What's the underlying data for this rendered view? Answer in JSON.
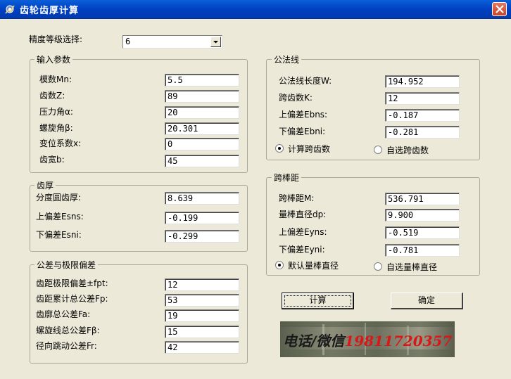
{
  "window": {
    "title": "齿轮齿厚计算",
    "close_label": "×"
  },
  "precision": {
    "label": "精度等级选择:",
    "value": "6"
  },
  "input_group": {
    "title": "输入参数",
    "fields": [
      {
        "label": "模数Mn:",
        "value": "5.5"
      },
      {
        "label": "齿数Z:",
        "value": "89"
      },
      {
        "label": "压力角α:",
        "value": "20"
      },
      {
        "label": "螺旋角β:",
        "value": "20.301"
      },
      {
        "label": "变位系数x:",
        "value": "0"
      },
      {
        "label": "齿宽b:",
        "value": "45"
      }
    ]
  },
  "thickness_group": {
    "title": "齿厚",
    "fields": [
      {
        "label": "分度圆齿厚:",
        "value": "8.639"
      },
      {
        "label": "上偏差Esns:",
        "value": "-0.199"
      },
      {
        "label": "下偏差Esni:",
        "value": "-0.299"
      }
    ]
  },
  "tolerance_group": {
    "title": "公差与极限偏差",
    "fields": [
      {
        "label": "齿距极限偏差±fpt:",
        "value": "12"
      },
      {
        "label": "齿距累计总公差Fp:",
        "value": "53"
      },
      {
        "label": "齿廓总公差Fa:",
        "value": "19"
      },
      {
        "label": "螺旋线总公差Fβ:",
        "value": "15"
      },
      {
        "label": "径向跳动公差Fr:",
        "value": "42"
      }
    ]
  },
  "normal_group": {
    "title": "公法线",
    "fields": [
      {
        "label": "公法线长度W:",
        "value": "194.952"
      },
      {
        "label": "跨齿数K:",
        "value": "12"
      },
      {
        "label": "上偏差Ebns:",
        "value": "-0.187"
      },
      {
        "label": "下偏差Ebni:",
        "value": "-0.281"
      }
    ],
    "radio_calc": "计算跨齿数",
    "radio_custom": "自选跨齿数"
  },
  "pin_group": {
    "title": "跨棒距",
    "fields": [
      {
        "label": "跨棒距M:",
        "value": "536.791"
      },
      {
        "label": "量棒直径dp:",
        "value": "9.900"
      },
      {
        "label": "上偏差Eyns:",
        "value": "-0.519"
      },
      {
        "label": "下偏差Eyni:",
        "value": "-0.781"
      }
    ],
    "radio_default": "默认量棒直径",
    "radio_custom": "自选量棒直径"
  },
  "buttons": {
    "calc": "计算",
    "ok": "确定"
  },
  "banner": {
    "text": "电话/微信19811720357"
  }
}
